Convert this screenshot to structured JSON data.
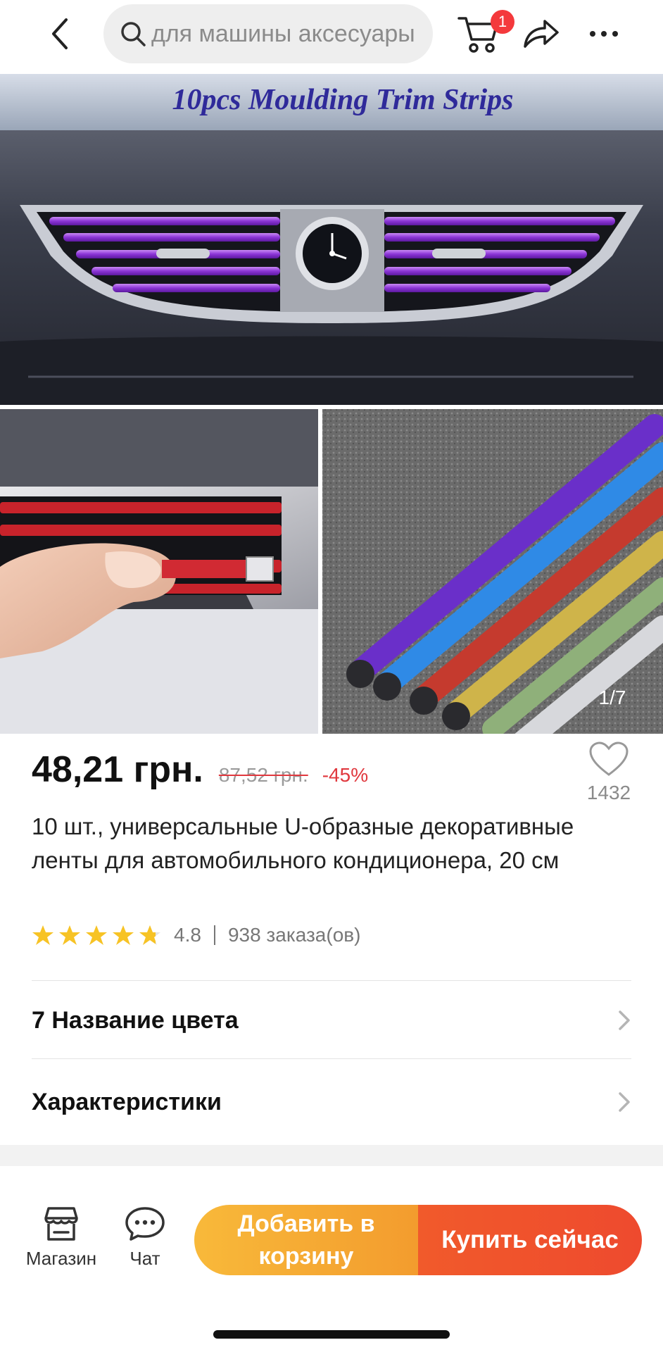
{
  "header": {
    "search_placeholder": "для машины аксесуары",
    "cart_badge": "1",
    "icons": [
      "back-arrow-icon",
      "search-icon",
      "cart-icon",
      "share-icon",
      "more-icon"
    ]
  },
  "gallery": {
    "banner_text": "10pcs Moulding Trim Strips",
    "page_indicator": "1/7"
  },
  "product": {
    "price": "48,21 грн.",
    "old_price": "87,52 грн.",
    "discount": "-45%",
    "wishlist_count": "1432",
    "title": "10 шт., универсальные U-образные декоративные ленты для автомобильного кондиционера, 20 см",
    "rating": "4.8",
    "rating_stars": 4.8,
    "orders": "938 заказа(ов)"
  },
  "options": {
    "color_row": "7 Название цвета",
    "specs_row": "Характеристики"
  },
  "bottom_bar": {
    "store_label": "Магазин",
    "chat_label": "Чат",
    "add_to_cart": "Добавить в корзину",
    "buy_now": "Купить сейчас"
  },
  "colors": {
    "accent_red": "#e0383e",
    "cta_orange": "#f6a935",
    "cta_red": "#ee4a2e",
    "star": "#f7c325"
  }
}
